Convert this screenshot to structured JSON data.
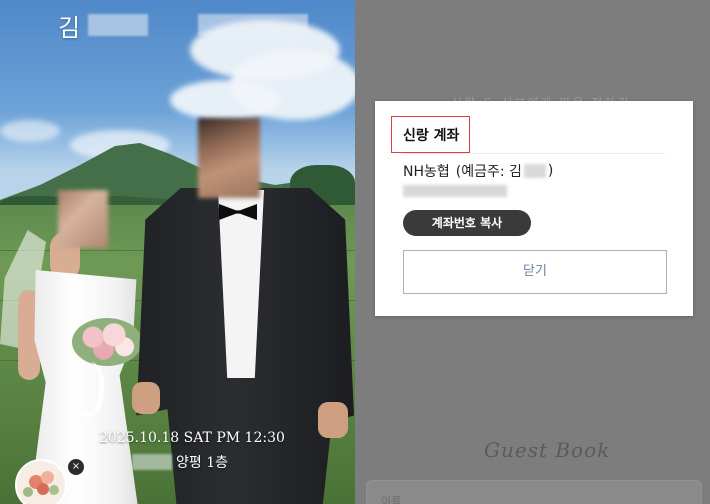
{
  "photo": {
    "name_initial": "김",
    "date_time": "2025.10.18 SAT PM 12:30",
    "venue_suffix": "양평 1층"
  },
  "music_badge": {
    "icon": "flower-bouquet-icon",
    "close_symbol": "×"
  },
  "page_background": {
    "faded_line": "신랑 & 신부에게 마음 전하기",
    "guestbook_title": "Guest Book",
    "name_input_placeholder": "이름"
  },
  "modal": {
    "title": "신랑 계좌",
    "bank_name": "NH농협",
    "holder_prefix": "(예금주: 김",
    "holder_suffix": ")",
    "copy_button_label": "계좌번호 복사",
    "close_button_label": "닫기"
  },
  "colors": {
    "highlight_border": "#e13b3b",
    "copy_button_bg": "#3a3a3a",
    "close_button_text": "#6a7fa8",
    "dim_overlay": "#7d7d7d"
  }
}
